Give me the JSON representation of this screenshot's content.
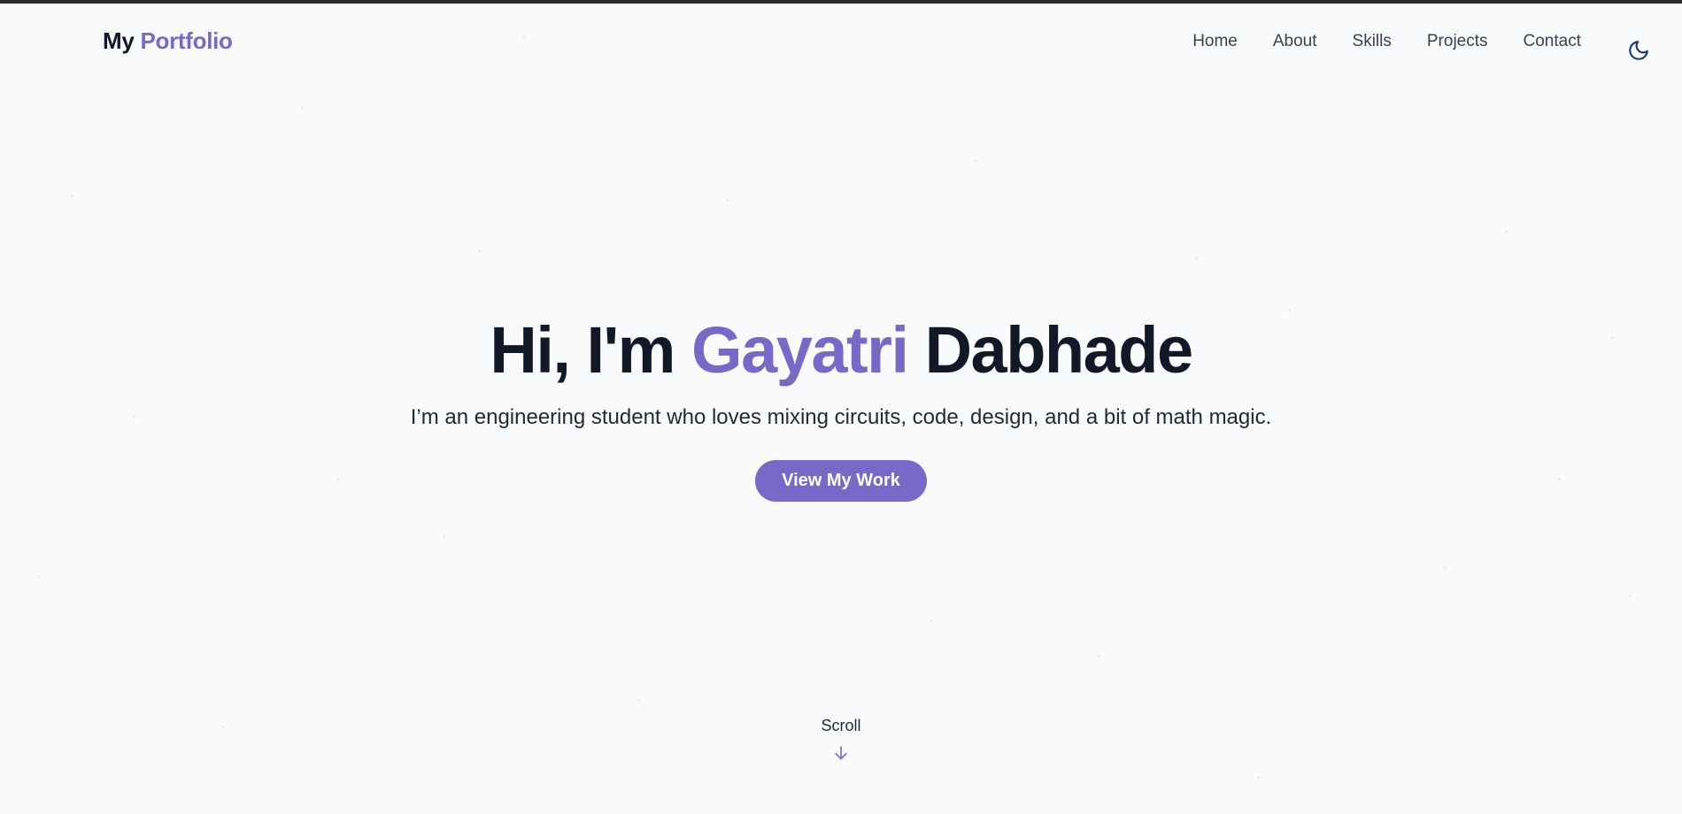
{
  "nav": {
    "logo_part1": "My",
    "logo_part2": "Portfolio",
    "links": [
      "Home",
      "About",
      "Skills",
      "Projects",
      "Contact"
    ],
    "theme_toggle_icon": "moon-icon"
  },
  "hero": {
    "greeting": "Hi, I'm",
    "first_name": "Gayatri",
    "last_name": "Dabhade",
    "subtitle": "I’m an engineering student who loves mixing circuits, code, design, and a bit of math magic.",
    "cta_label": "View My Work"
  },
  "scroll": {
    "label": "Scroll",
    "icon": "arrow-down-icon"
  },
  "colors": {
    "accent": "#7a68c8",
    "text_dark": "#111827",
    "background": "#f8fafc"
  }
}
